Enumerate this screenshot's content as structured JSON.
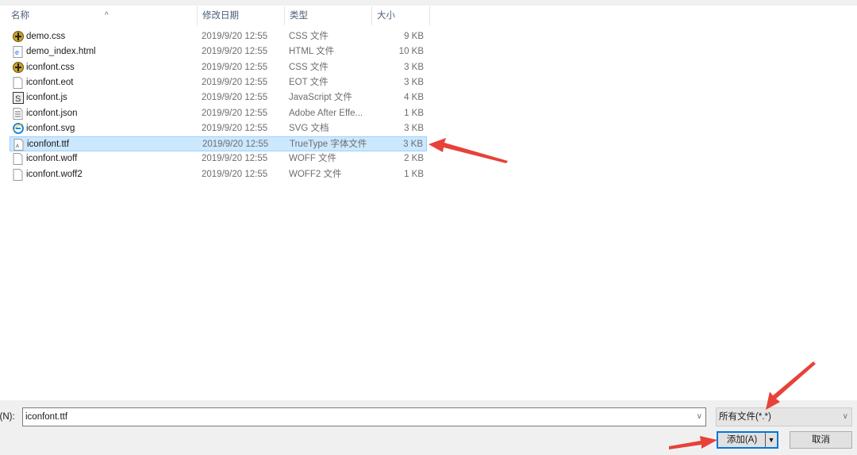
{
  "columns": {
    "name": "名称",
    "date": "修改日期",
    "type": "类型",
    "size": "大小"
  },
  "files": [
    {
      "name": "demo.css",
      "date": "2019/9/20 12:55",
      "type": "CSS 文件",
      "size": "9 KB",
      "icon": "css-icon"
    },
    {
      "name": "demo_index.html",
      "date": "2019/9/20 12:55",
      "type": "HTML 文件",
      "size": "10 KB",
      "icon": "html-icon"
    },
    {
      "name": "iconfont.css",
      "date": "2019/9/20 12:55",
      "type": "CSS 文件",
      "size": "3 KB",
      "icon": "css-icon"
    },
    {
      "name": "iconfont.eot",
      "date": "2019/9/20 12:55",
      "type": "EOT 文件",
      "size": "3 KB",
      "icon": "file-icon"
    },
    {
      "name": "iconfont.js",
      "date": "2019/9/20 12:55",
      "type": "JavaScript 文件",
      "size": "4 KB",
      "icon": "js-icon"
    },
    {
      "name": "iconfont.json",
      "date": "2019/9/20 12:55",
      "type": "Adobe After Effe...",
      "size": "1 KB",
      "icon": "text-file-icon"
    },
    {
      "name": "iconfont.svg",
      "date": "2019/9/20 12:55",
      "type": "SVG 文档",
      "size": "3 KB",
      "icon": "ie-icon"
    },
    {
      "name": "iconfont.ttf",
      "date": "2019/9/20 12:55",
      "type": "TrueType 字体文件",
      "size": "3 KB",
      "icon": "font-icon",
      "selected": true
    },
    {
      "name": "iconfont.woff",
      "date": "2019/9/20 12:55",
      "type": "WOFF 文件",
      "size": "2 KB",
      "icon": "file-icon"
    },
    {
      "name": "iconfont.woff2",
      "date": "2019/9/20 12:55",
      "type": "WOFF2 文件",
      "size": "1 KB",
      "icon": "file-icon"
    }
  ],
  "footer": {
    "filename_label": "名(N):",
    "filename_value": "iconfont.ttf",
    "filter_value": "所有文件(*.*)",
    "add_label": "添加(A)",
    "cancel_label": "取消"
  },
  "colors": {
    "selection": "#cce8ff",
    "arrow": "#e8413a"
  }
}
